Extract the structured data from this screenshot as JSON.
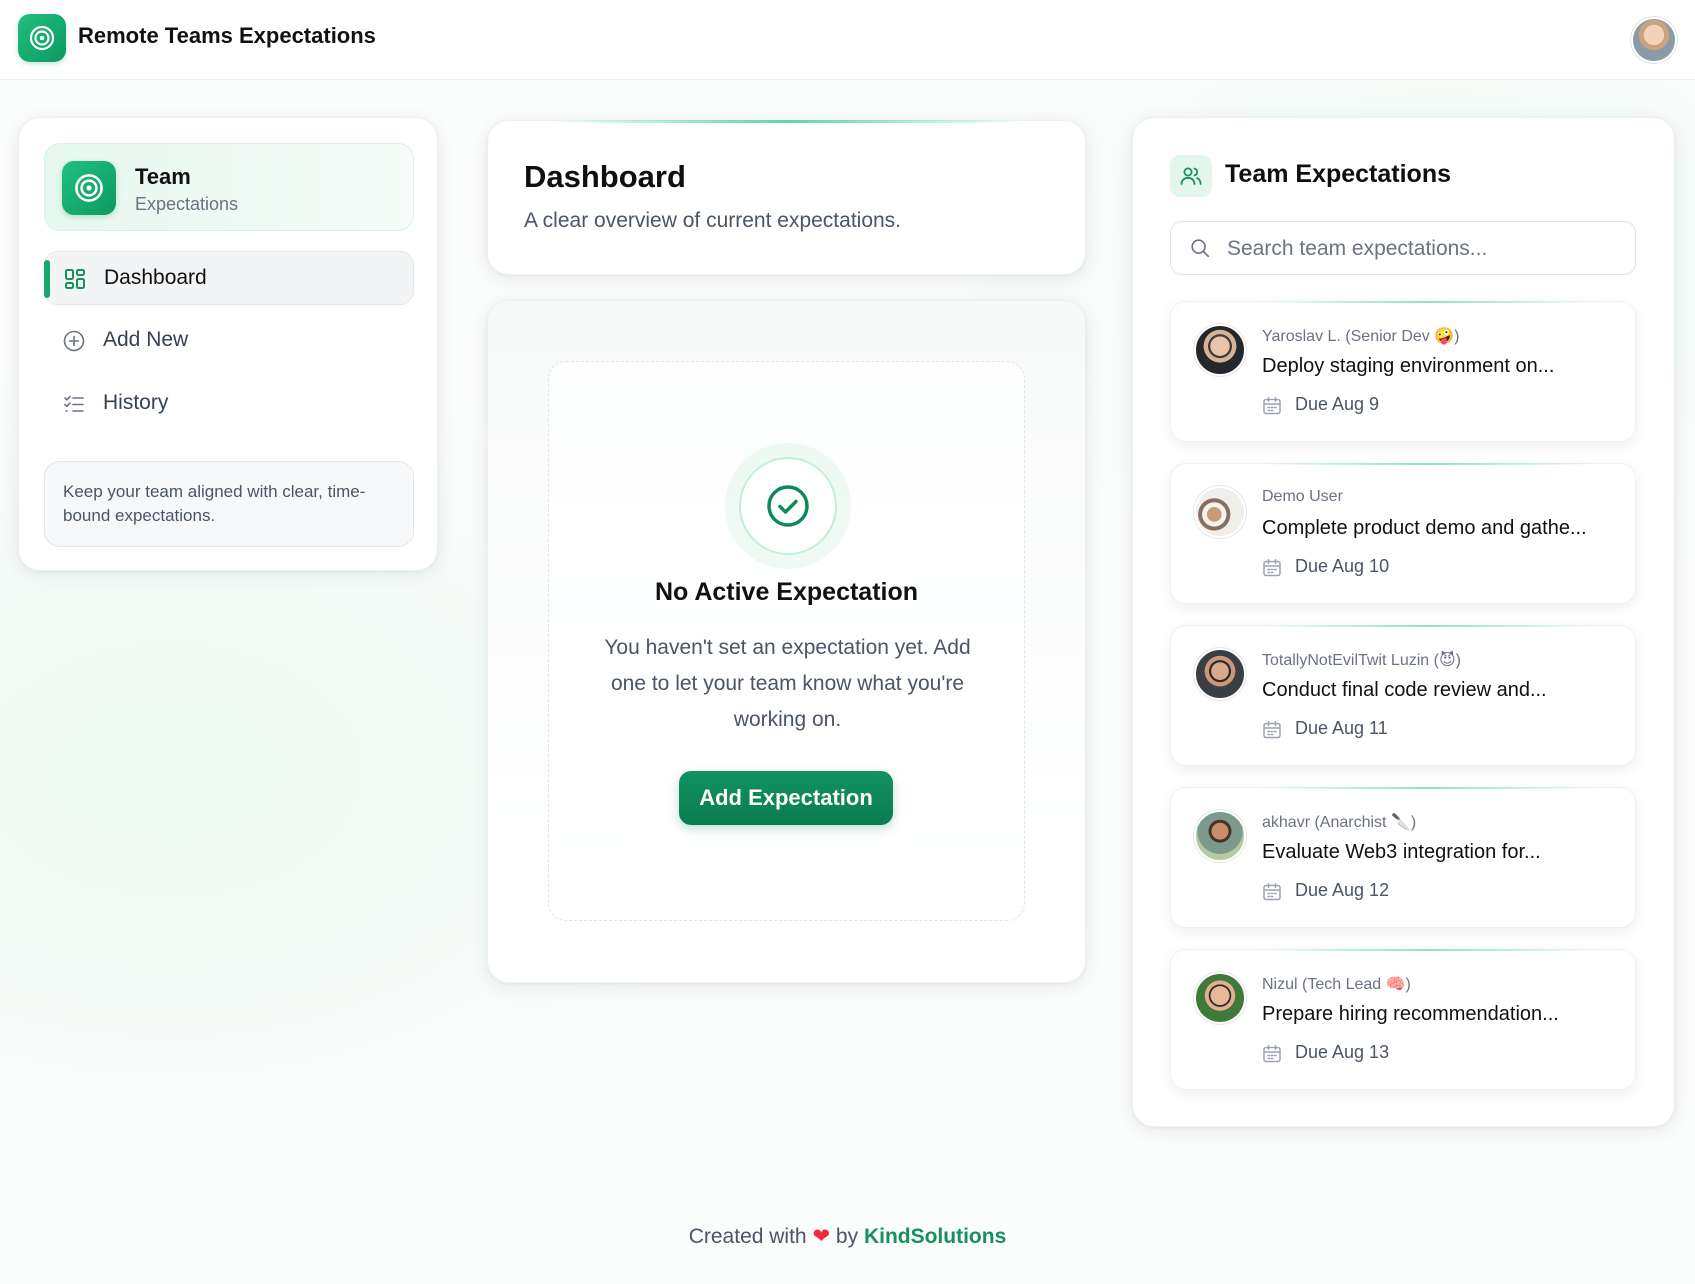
{
  "app": {
    "title": "Remote Teams Expectations"
  },
  "sidebar": {
    "team_name": "Team",
    "team_sub": "Expectations",
    "items": [
      {
        "label": "Dashboard",
        "icon": "dashboard-grid-icon",
        "active": true
      },
      {
        "label": "Add New",
        "icon": "plus-circle-icon",
        "active": false
      },
      {
        "label": "History",
        "icon": "list-check-icon",
        "active": false
      }
    ],
    "tip": "Keep your team aligned with clear, time-bound expectations."
  },
  "dashboard": {
    "title": "Dashboard",
    "subtitle": "A clear overview of current expectations."
  },
  "empty_state": {
    "title": "No Active Expectation",
    "text": "You haven't set an expectation yet. Add one to let your team know what you're working on.",
    "button": "Add Expectation"
  },
  "team_panel": {
    "title": "Team Expectations",
    "search_placeholder": "Search team expectations...",
    "items": [
      {
        "user": "Yaroslav L. (Senior Dev 🤪)",
        "task": "Deploy staging environment on...",
        "due": "Due Aug 9"
      },
      {
        "user": "Demo User",
        "task": "Complete product demo and gathe...",
        "due": "Due Aug 10"
      },
      {
        "user": "TotallyNotEvilTwit Luzin (😈)",
        "task": "Conduct final code review and...",
        "due": "Due Aug 11"
      },
      {
        "user": "akhavr (Anarchist 🔪)",
        "task": "Evaluate Web3 integration for...",
        "due": "Due Aug 12"
      },
      {
        "user": "Nizul (Tech Lead 🧠)",
        "task": "Prepare hiring recommendation...",
        "due": "Due Aug 13"
      }
    ]
  },
  "footer": {
    "prefix": "Created with",
    "heart": "❤",
    "by": "by",
    "brand": "KindSolutions"
  },
  "colors": {
    "accent": "#14915f",
    "button": "#0b7c52",
    "heart": "#ef2b3b"
  }
}
